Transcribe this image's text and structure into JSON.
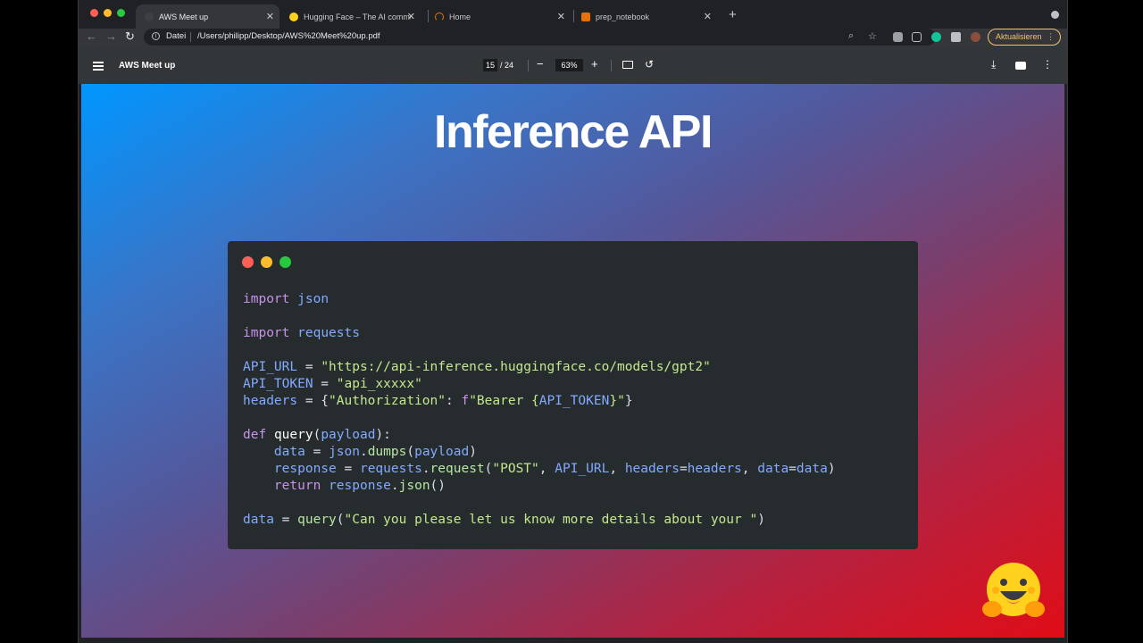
{
  "browser": {
    "tabs": [
      {
        "title": "AWS Meet up",
        "active": true
      },
      {
        "title": "Hugging Face – The AI commu",
        "active": false
      },
      {
        "title": "Home",
        "active": false
      },
      {
        "title": "prep_notebook",
        "active": false
      }
    ],
    "new_tab": "+",
    "scheme_label": "Datei",
    "url": "/Users/philipp/Desktop/AWS%20Meet%20up.pdf",
    "update_button": "Aktualisieren"
  },
  "pdf": {
    "title": "AWS Meet up",
    "page_current": "15",
    "page_total": "/ 24",
    "zoom": "63%",
    "zoom_out": "−",
    "zoom_in": "+"
  },
  "slide": {
    "title": "Inference API",
    "code_lines": [
      "import json",
      "",
      "import requests",
      "",
      "API_URL = \"https://api-inference.huggingface.co/models/gpt2\"",
      "API_TOKEN = \"api_xxxxx\"",
      "headers = {\"Authorization\": f\"Bearer {API_TOKEN}\"}",
      "",
      "def query(payload):",
      "    data = json.dumps(payload)",
      "    response = requests.request(\"POST\", API_URL, headers=headers, data=data)",
      "    return response.json()",
      "",
      "data = query(\"Can you please let us know more details about your \")"
    ]
  },
  "colors": {
    "gradient_start": "#0096ff",
    "gradient_end": "#e00d17",
    "code_bg": "#262b2e",
    "update_accent": "#f6c26b"
  }
}
